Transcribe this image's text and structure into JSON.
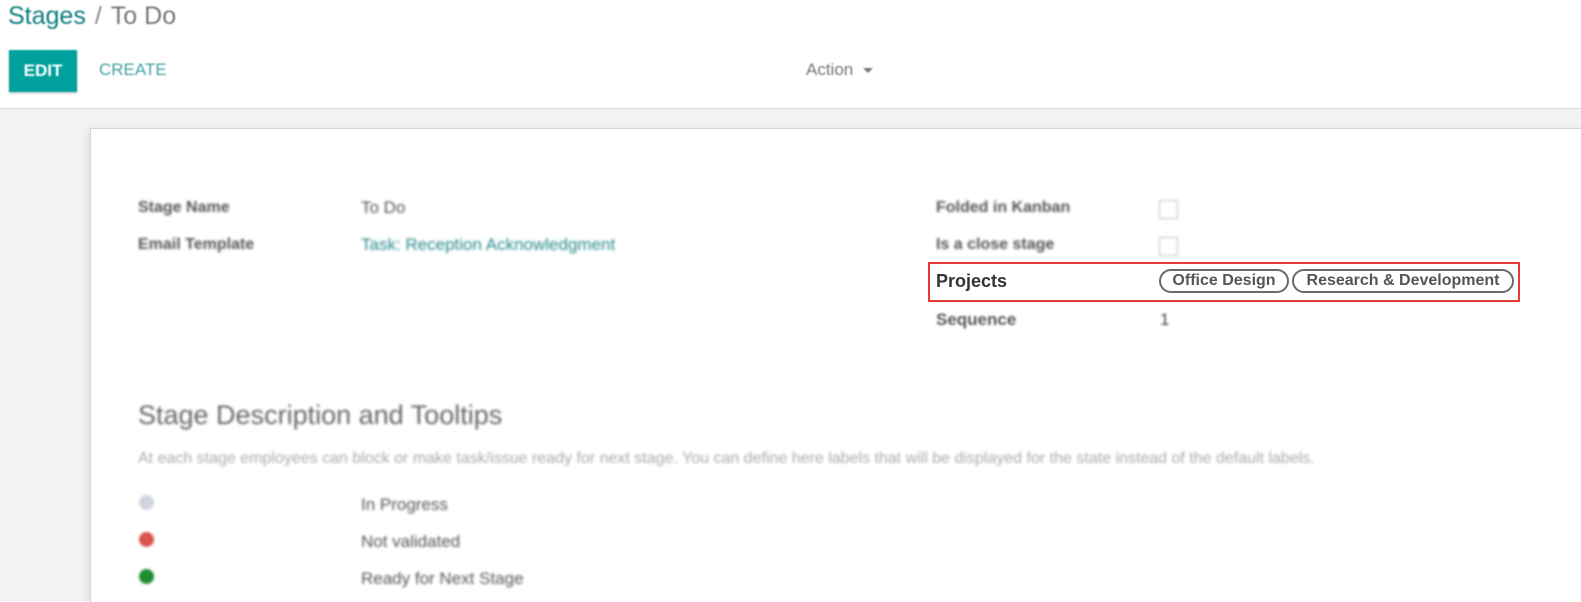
{
  "breadcrumb": {
    "parent": "Stages",
    "separator": "/",
    "current": "To Do"
  },
  "toolbar": {
    "edit_label": "EDIT",
    "create_label": "CREATE",
    "action_label": "Action"
  },
  "form": {
    "stage_name_label": "Stage Name",
    "stage_name_value": "To Do",
    "email_template_label": "Email Template",
    "email_template_value": "Task: Reception Acknowledgment",
    "folded_label": "Folded in Kanban",
    "folded_checked": false,
    "close_stage_label": "Is a close stage",
    "close_stage_checked": false,
    "projects_label": "Projects",
    "projects": [
      "Office Design",
      "Research & Development"
    ],
    "sequence_label": "Sequence",
    "sequence_value": "1"
  },
  "description": {
    "title": "Stage Description and Tooltips",
    "text": "At each stage employees can block or make task/issue ready for next stage. You can define here labels that will be displayed for the state instead of the default labels.",
    "legends": [
      {
        "color": "grey",
        "label": "In Progress"
      },
      {
        "color": "red",
        "label": "Not validated"
      },
      {
        "color": "green",
        "label": "Ready for Next Stage"
      }
    ]
  },
  "colors": {
    "accent": "#00a09d",
    "highlight": "#e83838"
  }
}
